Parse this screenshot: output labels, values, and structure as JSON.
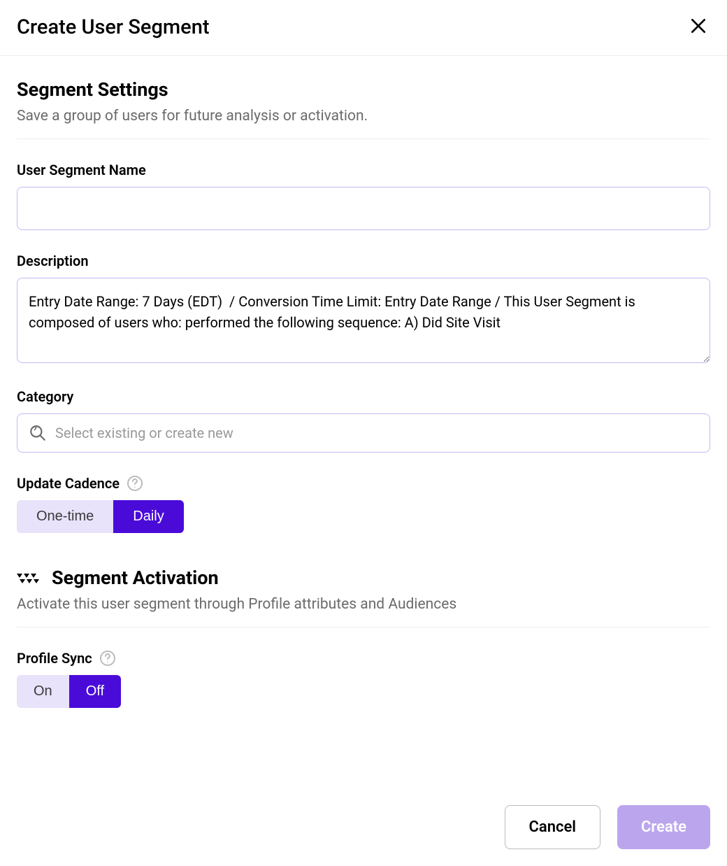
{
  "modal": {
    "title": "Create User Segment"
  },
  "settings": {
    "title": "Segment Settings",
    "subtitle": "Save a group of users for future analysis or activation.",
    "segment_name_label": "User Segment Name",
    "segment_name_value": "",
    "description_label": "Description",
    "description_value": "Entry Date Range: 7 Days (EDT)  / Conversion Time Limit: Entry Date Range / This User Segment is composed of users who: performed the following sequence: A) Did Site Visit",
    "category_label": "Category",
    "category_placeholder": "Select existing or create new",
    "cadence_label": "Update Cadence",
    "cadence_options": {
      "one_time": "One-time",
      "daily": "Daily"
    }
  },
  "activation": {
    "title": "Segment Activation",
    "subtitle": "Activate this user segment through Profile attributes and Audiences",
    "profile_sync_label": "Profile Sync",
    "profile_sync_options": {
      "on": "On",
      "off": "Off"
    }
  },
  "footer": {
    "cancel_label": "Cancel",
    "create_label": "Create"
  }
}
